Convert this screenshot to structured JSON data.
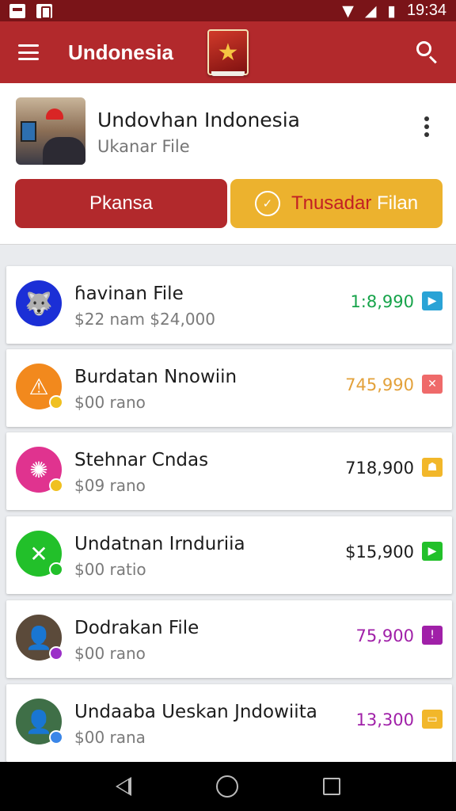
{
  "status_bar": {
    "time": "19:34"
  },
  "app_bar": {
    "title": "Undonesia"
  },
  "profile": {
    "title": "Undovhan Indonesia",
    "subtitle": "Ukanar File"
  },
  "actions": {
    "primary_label": "Pkansa",
    "secondary_label_part1": "Tnusadar",
    "secondary_label_part2": "Filan"
  },
  "items": [
    {
      "title": "ɦavinan File",
      "subtitle": "$22 nam $24,000",
      "amount": "1:8,990",
      "amount_color": "#16a34a",
      "avatar_color": "#1b2fd6",
      "avatar_icon": "wolf-icon",
      "badge_color": "#2aa3d6",
      "badge_icon": "play-icon"
    },
    {
      "title": "Burdatan Nnowiin",
      "subtitle": "$00 rano",
      "amount": "745,990",
      "amount_color": "#e3a13a",
      "avatar_color": "#f2891d",
      "avatar_icon": "warning-icon",
      "dot_color": "#f0c020",
      "badge_color": "#ef6a6a",
      "badge_icon": "close-icon"
    },
    {
      "title": "Stehnar Cndas",
      "subtitle": "$09 rano",
      "amount": "718,900",
      "amount_color": "#1c1c1c",
      "avatar_color": "#e0338f",
      "avatar_icon": "mask-icon",
      "dot_color": "#f0c020",
      "badge_color": "#f2b72a",
      "badge_icon": "person-icon"
    },
    {
      "title": "Undatnan Irnduriia",
      "subtitle": "$00 ratio",
      "amount": "$15,900",
      "amount_color": "#1c1c1c",
      "avatar_color": "#22c02a",
      "avatar_icon": "close-icon",
      "dot_color": "#22c02a",
      "badge_color": "#22c02a",
      "badge_icon": "play-icon"
    },
    {
      "title": "Dodrakan File",
      "subtitle": "$00 rano",
      "amount": "75,900",
      "amount_color": "#a020a8",
      "avatar_color": "#5b4a3a",
      "avatar_icon": "person-photo-icon",
      "dot_color": "#9b30c8",
      "badge_color": "#a020a8",
      "badge_icon": "warning-icon"
    },
    {
      "title": "Undaaba Ueskan Jndowiita",
      "subtitle": "$00 rana",
      "amount": "13,300",
      "amount_color": "#a020a8",
      "avatar_color": "#3f6f47",
      "avatar_icon": "person-photo-icon",
      "dot_color": "#3a86e8",
      "badge_color": "#f2b72a",
      "badge_icon": "chat-icon"
    }
  ]
}
